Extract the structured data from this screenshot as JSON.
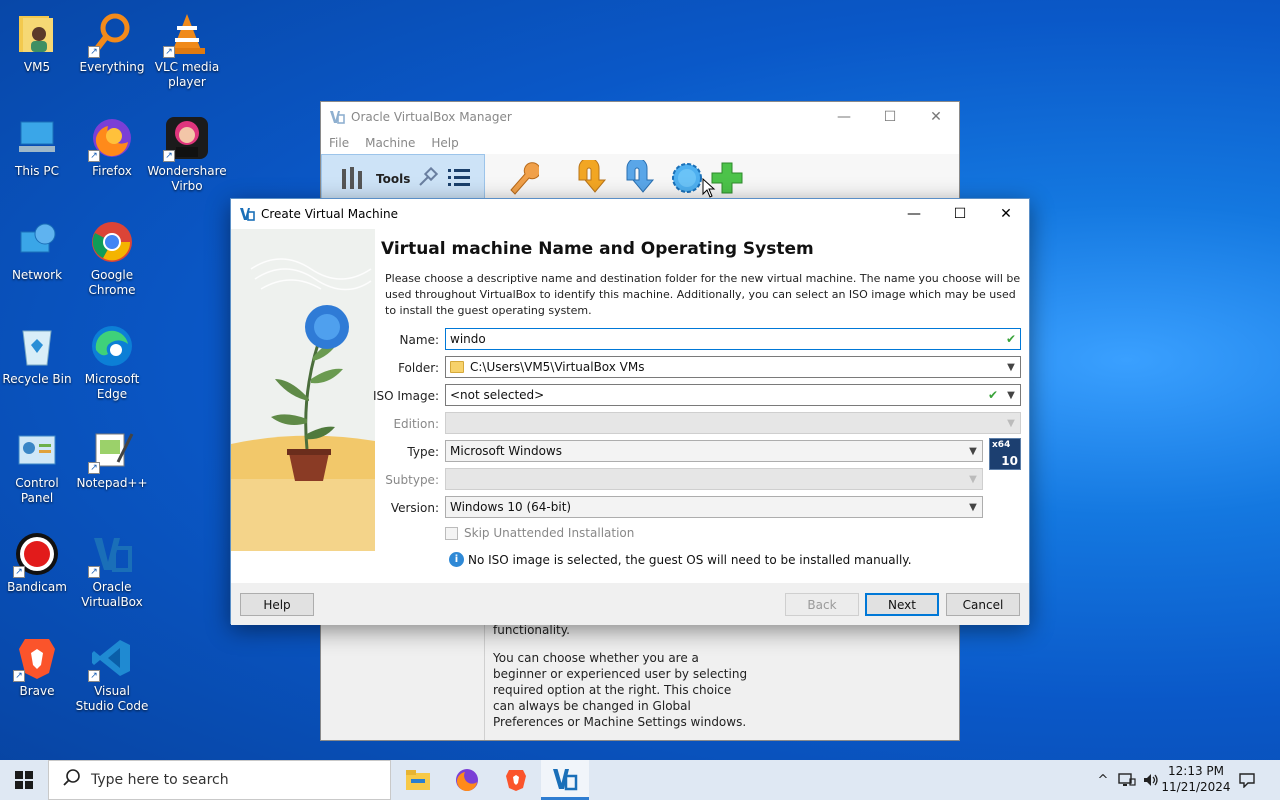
{
  "desktop": {
    "icons": [
      {
        "label": "VM5"
      },
      {
        "label": "Everything"
      },
      {
        "label": "VLC media player"
      },
      {
        "label": "This PC"
      },
      {
        "label": "Firefox"
      },
      {
        "label": "Wondershare Virbo"
      },
      {
        "label": "Network"
      },
      {
        "label": "Google Chrome"
      },
      {
        "label": "Recycle Bin"
      },
      {
        "label": "Microsoft Edge"
      },
      {
        "label": "Control Panel"
      },
      {
        "label": "Notepad++"
      },
      {
        "label": "Bandicam"
      },
      {
        "label": "Oracle VirtualBox"
      },
      {
        "label": "Brave"
      },
      {
        "label": "Visual Studio Code"
      }
    ]
  },
  "manager": {
    "title": "Oracle VirtualBox Manager",
    "menu": [
      "File",
      "Machine",
      "Help"
    ],
    "tools_label": "Tools",
    "content": [
      "functionality.",
      "You can choose whether you are a beginner or experienced user by selecting required option at the right. This choice can always be changed in Global Preferences or Machine Settings windows."
    ]
  },
  "dialog": {
    "title": "Create Virtual Machine",
    "heading": "Virtual machine Name and Operating System",
    "description": "Please choose a descriptive name and destination folder for the new virtual machine. The name you choose will be used throughout VirtualBox to identify this machine. Additionally, you can select an ISO image which may be used to install the guest operating system.",
    "labels": {
      "name": "Name:",
      "folder": "Folder:",
      "iso": "ISO Image:",
      "edition": "Edition:",
      "type": "Type:",
      "subtype": "Subtype:",
      "version": "Version:"
    },
    "values": {
      "name": "windo",
      "folder": "C:\\Users\\VM5\\VirtualBox VMs",
      "iso": "<not selected>",
      "edition": "",
      "type": "Microsoft Windows",
      "subtype": "",
      "version": "Windows 10 (64-bit)"
    },
    "os_badge": {
      "arch": "x64",
      "ver": "10"
    },
    "skip_unattended": "Skip Unattended Installation",
    "info": "No ISO image is selected, the guest OS will need to be installed manually.",
    "buttons": {
      "help": "Help",
      "back": "Back",
      "next": "Next",
      "cancel": "Cancel"
    }
  },
  "taskbar": {
    "search_placeholder": "Type here to search",
    "time": "12:13 PM",
    "date": "11/21/2024"
  },
  "colors": {
    "accent": "#0078d7",
    "check_green": "#3aa33a",
    "vbox_blue": "#1a6fb8"
  }
}
